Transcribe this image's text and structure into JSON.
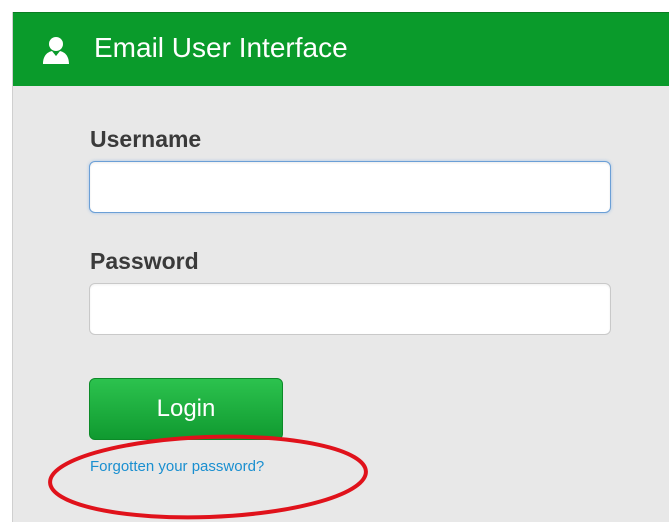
{
  "header": {
    "title": "Email User Interface",
    "icon": "user-icon",
    "background_color": "#0a9b2b"
  },
  "form": {
    "username_label": "Username",
    "username_value": "",
    "password_label": "Password",
    "password_value": "",
    "login_label": "Login",
    "forgot_link": "Forgotten your password?"
  },
  "colors": {
    "panel_background": "#e8e8e8",
    "login_button": "#1aa83a",
    "link": "#1a8fd0",
    "annotation": "#e0121b"
  }
}
